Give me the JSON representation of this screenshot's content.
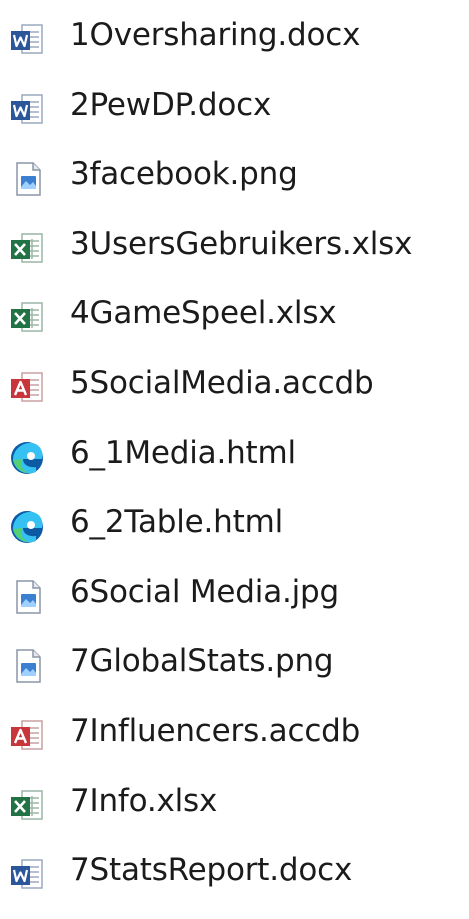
{
  "files": [
    {
      "name": "1Oversharing.docx",
      "icon": "word-icon"
    },
    {
      "name": "2PewDP.docx",
      "icon": "word-icon"
    },
    {
      "name": "3facebook.png",
      "icon": "image-icon"
    },
    {
      "name": "3UsersGebruikers.xlsx",
      "icon": "excel-icon"
    },
    {
      "name": "4GameSpeel.xlsx",
      "icon": "excel-icon"
    },
    {
      "name": "5SocialMedia.accdb",
      "icon": "access-icon"
    },
    {
      "name": "6_1Media.html",
      "icon": "edge-icon"
    },
    {
      "name": "6_2Table.html",
      "icon": "edge-icon"
    },
    {
      "name": "6Social Media.jpg",
      "icon": "image-icon"
    },
    {
      "name": "7GlobalStats.png",
      "icon": "image-icon"
    },
    {
      "name": "7Influencers.accdb",
      "icon": "access-icon"
    },
    {
      "name": "7Info.xlsx",
      "icon": "excel-icon"
    },
    {
      "name": "7StatsReport.docx",
      "icon": "word-icon"
    }
  ],
  "colors": {
    "word": "#2b579a",
    "excel": "#217346",
    "access": "#c8353a",
    "image": "#3a7fd0",
    "edge_dark": "#0c59a4",
    "edge_light": "#35c1f1",
    "edge_green": "#54d074",
    "text": "#1b1b1b"
  }
}
